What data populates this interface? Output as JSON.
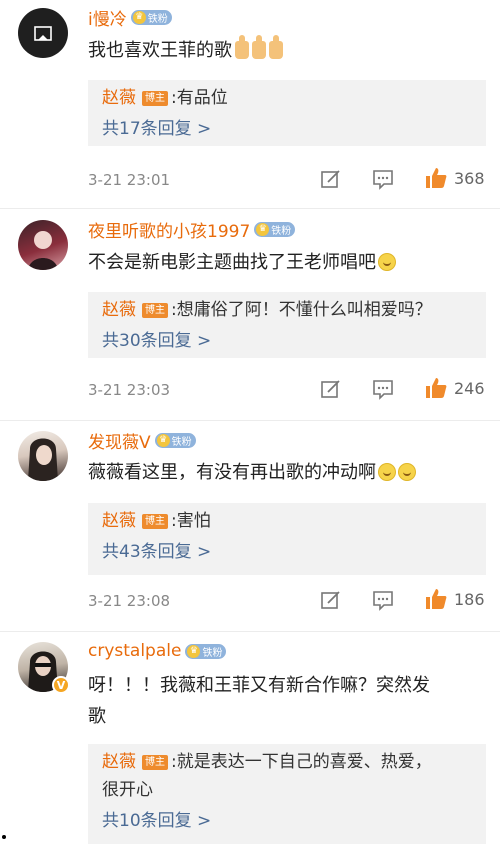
{
  "comments": [
    {
      "username": "i慢冷",
      "badge": "铁粉",
      "content": "我也喜欢王菲的歌",
      "reply_author": "赵薇",
      "reply_tag": "博主",
      "reply_text": ":有品位",
      "reply_count": "共17条回复 >",
      "time": "3-21 23:01",
      "likes": "368"
    },
    {
      "username": "夜里听歌的小孩1997",
      "badge": "铁粉",
      "content": "不会是新电影主题曲找了王老师唱吧",
      "reply_author": "赵薇",
      "reply_tag": "博主",
      "reply_text": ":想庸俗了阿！不懂什么叫相爱吗？",
      "reply_count": "共30条回复 >",
      "time": "3-21 23:03",
      "likes": "246"
    },
    {
      "username": "发现薇V",
      "badge": "铁粉",
      "content": "薇薇看这里，有没有再出歌的冲动啊",
      "reply_author": "赵薇",
      "reply_tag": "博主",
      "reply_text": ":害怕",
      "reply_count": "共43条回复 >",
      "time": "3-21 23:08",
      "likes": "186"
    },
    {
      "username": "crystalpale",
      "badge": "铁粉",
      "content_line1": "呀！！！我薇和王菲又有新合作嘛？突然发",
      "content_line2": "歌",
      "reply_author": "赵薇",
      "reply_tag": "博主",
      "reply_text_line1": ":就是表达一下自己的喜爱、热爱，",
      "reply_text_line2": "很开心",
      "reply_count": "共10条回复 >"
    }
  ],
  "colors": {
    "username": "#e86b0c",
    "reply_count": "#4a6a94",
    "like_icon": "#f08a2b",
    "reply_bg": "#f2f2f2"
  },
  "icons": [
    "edit-icon",
    "comment-icon",
    "like-icon",
    "verified-icon"
  ]
}
